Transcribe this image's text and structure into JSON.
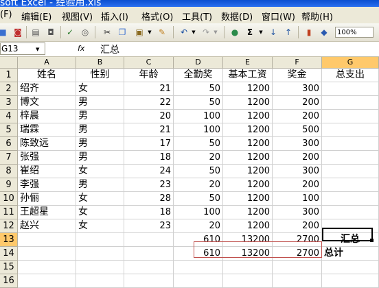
{
  "window": {
    "title": "soft Excel - 经验用.xls"
  },
  "menu": [
    "(F)",
    "编辑(E)",
    "视图(V)",
    "插入(I)",
    "格式(O)",
    "工具(T)",
    "数据(D)",
    "窗口(W)",
    "帮助(H)"
  ],
  "toolbar": {
    "zoom": "100%",
    "sum": "Σ"
  },
  "formula_bar": {
    "name_box": "G13",
    "fx": "fx",
    "content": "汇总"
  },
  "columns": [
    "A",
    "B",
    "C",
    "D",
    "E",
    "F",
    "G"
  ],
  "rows": [
    "1",
    "2",
    "3",
    "4",
    "5",
    "6",
    "7",
    "8",
    "9",
    "10",
    "11",
    "12",
    "13",
    "14",
    "15",
    "16"
  ],
  "headers": [
    "姓名",
    "性别",
    "年龄",
    "全勤奖",
    "基本工资",
    "奖金",
    "总支出"
  ],
  "data": [
    [
      "绍齐",
      "女",
      "21",
      "50",
      "1200",
      "300"
    ],
    [
      "博文",
      "男",
      "22",
      "50",
      "1200",
      "200"
    ],
    [
      "梓晨",
      "男",
      "20",
      "100",
      "1200",
      "200"
    ],
    [
      "瑞霖",
      "男",
      "21",
      "100",
      "1200",
      "500"
    ],
    [
      "陈致远",
      "男",
      "17",
      "50",
      "1200",
      "300"
    ],
    [
      "张强",
      "男",
      "18",
      "20",
      "1200",
      "200"
    ],
    [
      "崔绍",
      "女",
      "24",
      "50",
      "1200",
      "300"
    ],
    [
      "李强",
      "男",
      "23",
      "20",
      "1200",
      "200"
    ],
    [
      "孙俪",
      "女",
      "28",
      "50",
      "1200",
      "100"
    ],
    [
      "王超星",
      "女",
      "18",
      "100",
      "1200",
      "300"
    ],
    [
      "赵兴",
      "女",
      "23",
      "20",
      "1200",
      "200"
    ]
  ],
  "row13": {
    "d": "610",
    "e": "13200",
    "f": "2700",
    "g": "汇总"
  },
  "row14": {
    "d": "610",
    "e": "13200",
    "f": "2700",
    "g": "总计"
  }
}
